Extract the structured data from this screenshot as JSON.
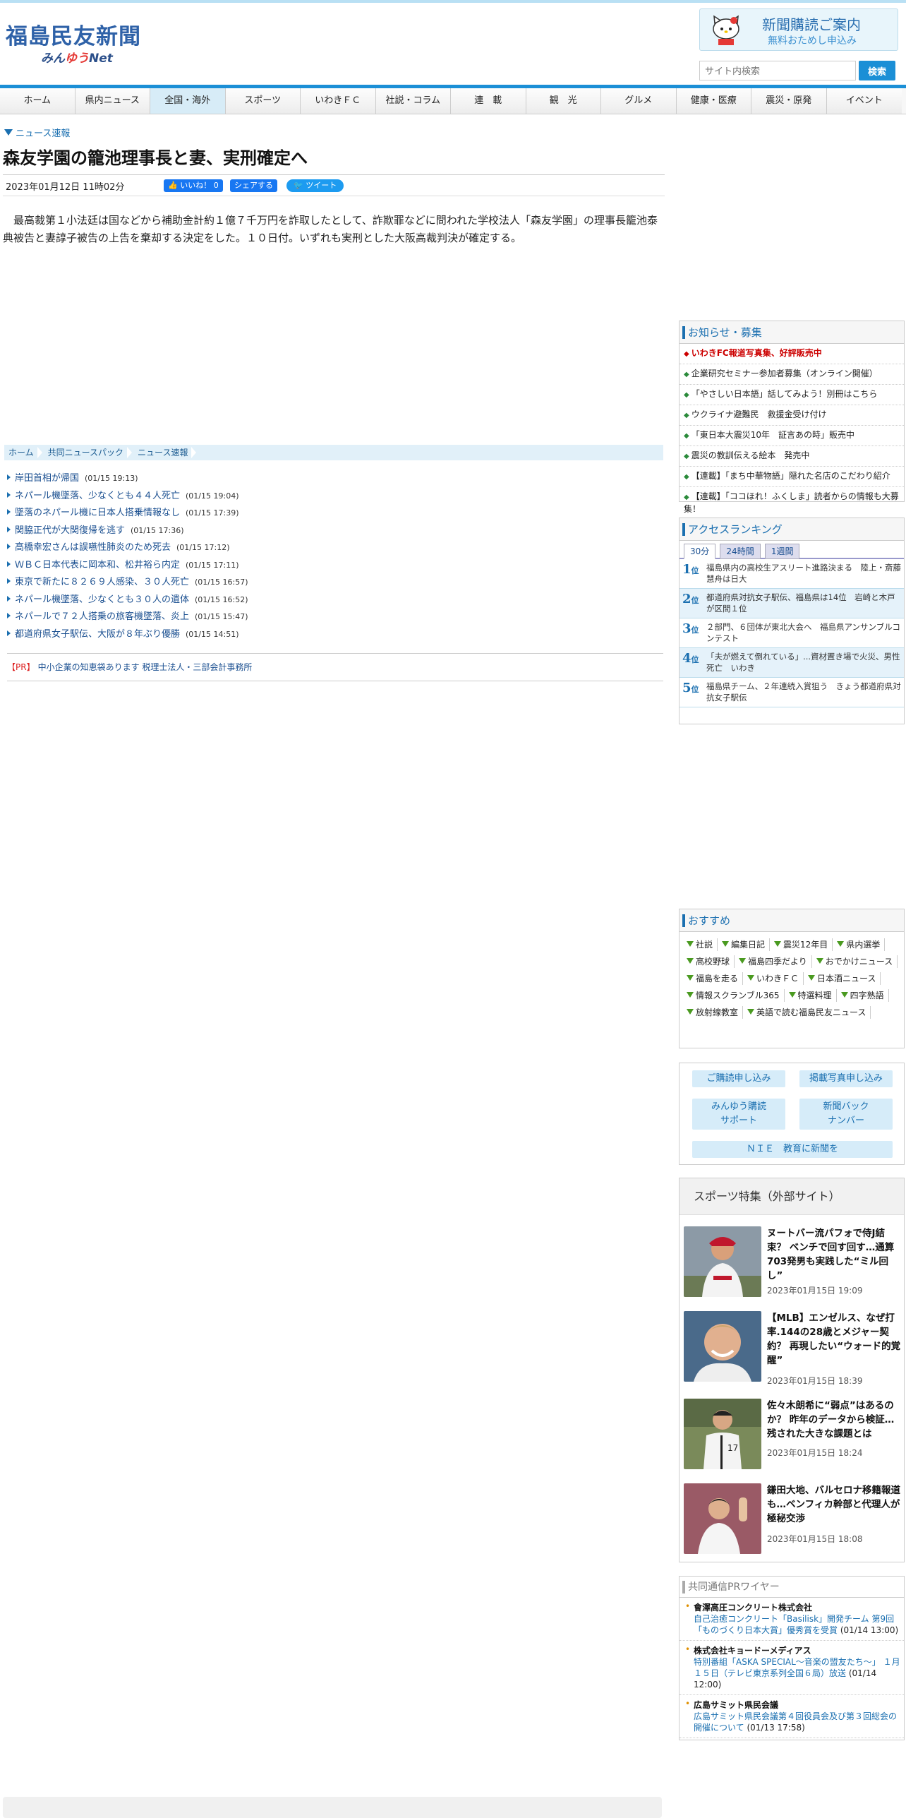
{
  "site": {
    "logo_main": "福島民友新聞",
    "logo_sub_a": "みん",
    "logo_sub_b": "ゆう",
    "logo_sub_c": "Net"
  },
  "banner": {
    "title": "新聞購読ご案内",
    "sub": "無料おためし申込み"
  },
  "search": {
    "placeholder": "サイト内検索",
    "button": "検索"
  },
  "nav": [
    "ホーム",
    "県内ニュース",
    "全国・海外",
    "スポーツ",
    "いわきＦＣ",
    "社説・コラム",
    "連　載",
    "観　光",
    "グルメ",
    "健康・医療",
    "震災・原発",
    "イベント"
  ],
  "article": {
    "category": "ニュース速報",
    "title": "森友学園の籠池理事長と妻、実刑確定へ",
    "date": "2023年01月12日 11時02分",
    "like": "いいね！ 0",
    "share": "シェアする",
    "tweet": "ツイート",
    "body": "最高裁第１小法廷は国などから補助金計約１億７千万円を詐取したとして、詐欺罪などに問われた学校法人「森友学園」の理事長籠池泰典被告と妻諄子被告の上告を棄却する決定をした。１０日付。いずれも実刑とした大阪高裁判決が確定する。"
  },
  "breadcrumb": [
    "ホーム",
    "共同ニュースパック",
    "ニュース速報"
  ],
  "news_list": [
    {
      "title": "岸田首相が帰国",
      "time": "(01/15 19:13)"
    },
    {
      "title": "ネパール機墜落、少なくとも４４人死亡",
      "time": "(01/15 19:04)"
    },
    {
      "title": "墜落のネパール機に日本人搭乗情報なし",
      "time": "(01/15 17:39)"
    },
    {
      "title": "関脇正代が大関復帰を逃す",
      "time": "(01/15 17:36)"
    },
    {
      "title": "高橋幸宏さんは誤嚥性肺炎のため死去",
      "time": "(01/15 17:12)"
    },
    {
      "title": "ＷＢＣ日本代表に岡本和、松井裕ら内定",
      "time": "(01/15 17:11)"
    },
    {
      "title": "東京で新たに８２６９人感染、３０人死亡",
      "time": "(01/15 16:57)"
    },
    {
      "title": "ネパール機墜落、少なくとも３０人の遺体",
      "time": "(01/15 16:52)"
    },
    {
      "title": "ネパールで７２人搭乗の旅客機墜落、炎上",
      "time": "(01/15 15:47)"
    },
    {
      "title": "都道府県女子駅伝、大阪が８年ぶり優勝",
      "time": "(01/15 14:51)"
    }
  ],
  "pr": {
    "tag": "【PR】",
    "text": "中小企業の知恵袋あります 税理士法人・三部会計事務所"
  },
  "notices": {
    "title": "お知らせ・募集",
    "items": [
      "いわきFC報道写真集、好評販売中",
      "企業研究セミナー参加者募集（オンライン開催）",
      "「やさしい日本語」話してみよう！別冊はこちら",
      "ウクライナ避難民　救援金受け付け",
      "「東日本大震災10年　証言あの時」販売中",
      "震災の教訓伝える絵本　発売中",
      "【連載】「まち中華物語」隠れた名店のこだわり紹介",
      "【連載】「ココほれ！ふくしま」読者からの情報も大募集！"
    ]
  },
  "ranking": {
    "title": "アクセスランキング",
    "tabs": [
      "30分",
      "24時間",
      "1週間"
    ],
    "rank_suffix": "位",
    "items": [
      {
        "rank": "1",
        "text": "福島県内の高校生アスリート進路決まる　陸上・斎藤慧舟は日大"
      },
      {
        "rank": "2",
        "text": "都道府県対抗女子駅伝、福島県は14位　岩崎と木戸が区間１位"
      },
      {
        "rank": "3",
        "text": "２部門、６団体が東北大会へ　福島県アンサンブルコンテスト"
      },
      {
        "rank": "4",
        "text": "「夫が燃えて倒れている」...資材置き場で火災、男性死亡　いわき"
      },
      {
        "rank": "5",
        "text": "福島県チーム、２年連続入賞狙う　きょう都道府県対抗女子駅伝"
      }
    ]
  },
  "recommend": {
    "title": "おすすめ",
    "tags": [
      "社説",
      "編集日記",
      "震災12年目",
      "県内選挙",
      "高校野球",
      "福島四季だより",
      "おでかけニュース",
      "福島を走る",
      "いわきＦＣ",
      "日本酒ニュース",
      "情報スクランブル365",
      "特選料理",
      "四字熟語",
      "放射線教室",
      "英語で読む福島民友ニュース"
    ]
  },
  "service_links": [
    "ご購読申し込み",
    "掲載写真申し込み",
    "みんゆう購読サポート",
    "新聞バックナンバー",
    "ＮＩＥ　教育に新聞を"
  ],
  "sports": {
    "title": "スポーツ特集（外部サイト）",
    "items": [
      {
        "title": "ヌートバー流パフォで侍J結束？ ベンチで回す回す…通算703発男も実践した“ミル回し”",
        "date": "2023年01月15日 19:09"
      },
      {
        "title": "【MLB】エンゼルス、なぜ打率.144の28歳とメジャー契約？ 再現したい“ウォード的覚醒”",
        "date": "2023年01月15日 18:39"
      },
      {
        "title": "佐々木朗希に“弱点”はあるのか？ 昨年のデータから検証…残された大きな課題とは",
        "date": "2023年01月15日 18:24"
      },
      {
        "title": "鎌田大地、バルセロナ移籍報道も…ベンフィカ幹部と代理人が極秘交渉",
        "date": "2023年01月15日 18:08"
      }
    ]
  },
  "kyodo_pr": {
    "title": "共同通信PRワイヤー",
    "items": [
      {
        "company": "會澤高圧コンクリート株式会社",
        "text": "自己治癒コンクリート「Basilisk」開発チーム 第9回「ものづくり日本大賞」優秀賞を受賞",
        "time": "(01/14 13:00)"
      },
      {
        "company": "株式会社キョードーメディアス",
        "text": "特別番組「ASKA SPECIAL～音楽の盟友たち～」 １月１５日（テレビ東京系列全国６局）放送",
        "time": "(01/14 12:00)"
      },
      {
        "company": "広島サミット県民会議",
        "text": "広島サミット県民会議第４回役員会及び第３回総会の開催について",
        "time": "(01/13 17:58)"
      }
    ]
  },
  "colors": {
    "brand_blue": "#1b8fd6",
    "link_blue": "#1a6fb0",
    "notice_red": "#c00"
  }
}
